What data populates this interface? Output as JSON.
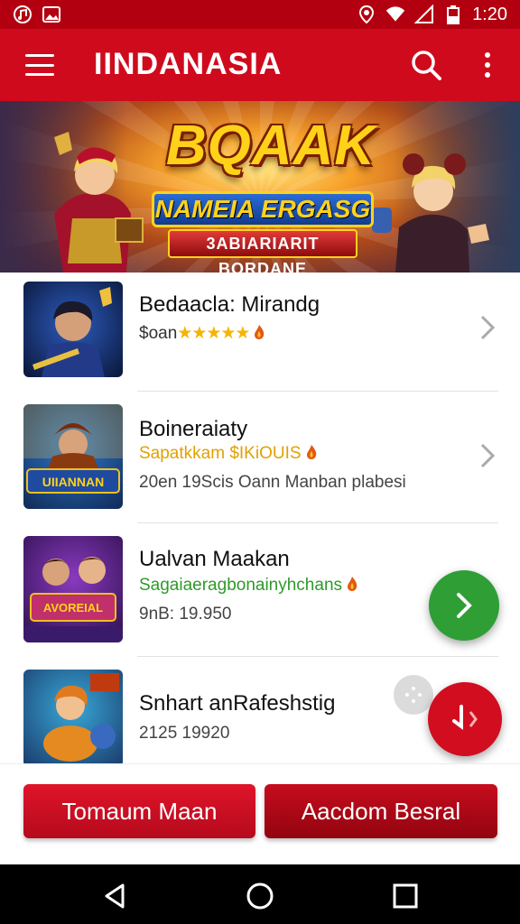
{
  "status_bar": {
    "time": "1:20",
    "icons": [
      "music-note-icon",
      "image-icon",
      "location-icon",
      "wifi-icon",
      "no-signal-icon",
      "battery-icon"
    ]
  },
  "app_bar": {
    "title": "IINDANASIA",
    "icons": [
      "menu-icon",
      "search-icon",
      "more-vert-icon"
    ]
  },
  "banner": {
    "title": "BQAAK",
    "subtitle": "NAMEIA ERGASG",
    "ribbon": "3ABIARIARIT BORDANE"
  },
  "games": [
    {
      "title": "Bedaacla: Mirandg",
      "line2_prefix": "$oan",
      "line2_stars": "★★★★★",
      "line2_color": "#333333",
      "line3": ""
    },
    {
      "title": "Boineraiaty",
      "line2_text": "Sapatkkam $IKiOUIS",
      "line2_color": "#e3a000",
      "line3": "20en 19Scis Oann Manban plabesi"
    },
    {
      "title": "Ualvan Maakan",
      "line2_text": "Sagaiaeragbonainyhchans",
      "line2_color": "#2e9a2a",
      "line3": "9nB: 19.950"
    },
    {
      "title": "Snhart anRafeshstig",
      "line2_text": "2125 19920",
      "line2_color": "#444444",
      "line3": ""
    }
  ],
  "buttons": {
    "left": "Tomaum Maan",
    "right": "Aacdom Besral"
  },
  "nav": [
    "back-icon",
    "home-icon",
    "recents-icon"
  ],
  "colors": {
    "primary": "#cf0a1c",
    "status_bar": "#b30010",
    "fab_green": "#2f9e35",
    "fab_red": "#d10d1f"
  }
}
